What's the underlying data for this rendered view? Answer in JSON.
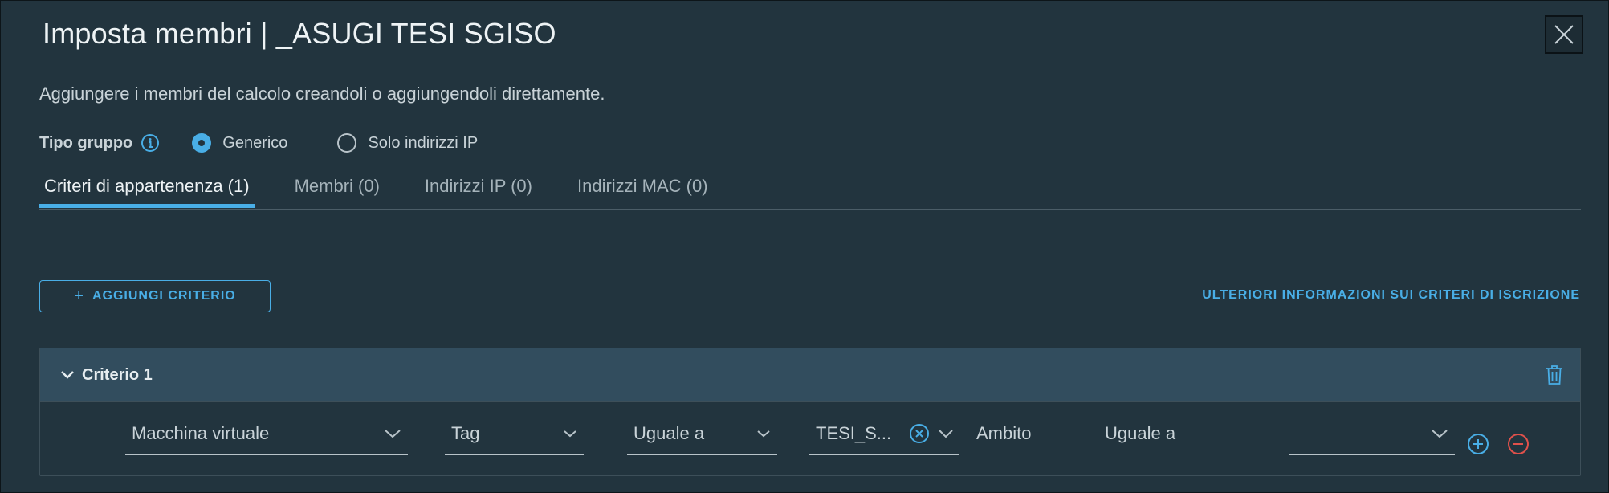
{
  "dialog": {
    "title": "Imposta membri | _ASUGI TESI SGISO",
    "subtitle": "Aggiungere i membri del calcolo creandoli o aggiungendoli direttamente."
  },
  "group_type": {
    "label": "Tipo gruppo",
    "options": [
      {
        "label": "Generico",
        "selected": true
      },
      {
        "label": "Solo indirizzi IP",
        "selected": false
      }
    ]
  },
  "tabs": [
    {
      "label": "Criteri di appartenenza (1)",
      "active": true
    },
    {
      "label": "Membri (0)",
      "active": false
    },
    {
      "label": "Indirizzi IP (0)",
      "active": false
    },
    {
      "label": "Indirizzi MAC (0)",
      "active": false
    }
  ],
  "actions": {
    "add_criterion": "AGGIUNGI CRITERIO",
    "more_info": "ULTERIORI INFORMAZIONI SUI CRITERI DI ISCRIZIONE"
  },
  "criterion": {
    "title": "Criterio 1",
    "object_type": "Macchina virtuale",
    "property": "Tag",
    "operator": "Uguale a",
    "tag_value": "TESI_S...",
    "scope_label": "Ambito",
    "scope_operator": "Uguale a",
    "scope_value": ""
  },
  "colors": {
    "background": "#22343e",
    "accent": "#49aee6",
    "remove": "#e0514b",
    "panel_header": "#324d5e"
  },
  "icons": [
    "close-icon",
    "info-icon",
    "chevron-down-icon",
    "trash-icon",
    "clear-circle-icon",
    "plus-circle-icon",
    "minus-circle-icon"
  ]
}
